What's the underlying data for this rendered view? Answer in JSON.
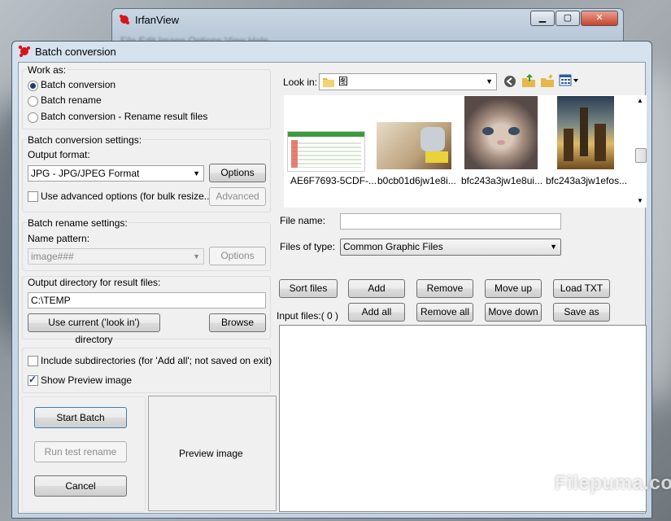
{
  "background_window": {
    "title": "IrfanView",
    "menu": "File Edit Image Options View Help"
  },
  "dialog": {
    "title": "Batch conversion"
  },
  "work_as": {
    "label": "Work as:",
    "options": [
      "Batch conversion",
      "Batch rename",
      "Batch conversion - Rename result files"
    ],
    "selected": "Batch conversion"
  },
  "conversion_settings": {
    "label": "Batch conversion settings:",
    "output_format_label": "Output format:",
    "output_format_value": "JPG - JPG/JPEG Format",
    "options_button": "Options",
    "advanced_checkbox": "Use advanced options (for bulk resize...)",
    "advanced_button": "Advanced"
  },
  "rename_settings": {
    "label": "Batch rename settings:",
    "name_pattern_label": "Name pattern:",
    "name_pattern_value": "image###",
    "options_button": "Options"
  },
  "output_dir": {
    "label": "Output directory for result files:",
    "value": "C:\\TEMP",
    "use_current_button": "Use current ('look in') directory",
    "browse_button": "Browse"
  },
  "include_subdirs": "Include subdirectories (for 'Add all'; not saved on exit)",
  "show_preview": "Show Preview image",
  "actions": {
    "start": "Start Batch",
    "test_rename": "Run test rename",
    "cancel": "Cancel"
  },
  "preview_label": "Preview image",
  "look_in": {
    "label": "Look in:",
    "value": "图"
  },
  "thumbnails": [
    "AE6F7693-5CDF-...",
    "b0cb01d6jw1e8i...",
    "bfc243a3jw1e8ui...",
    "bfc243a3jw1efos..."
  ],
  "file_name_label": "File name:",
  "file_name_value": "",
  "files_of_type": {
    "label": "Files of type:",
    "value": "Common Graphic Files"
  },
  "buttons": {
    "sort_files": "Sort files",
    "add": "Add",
    "remove": "Remove",
    "move_up": "Move up",
    "load_txt": "Load TXT",
    "add_all": "Add all",
    "remove_all": "Remove all",
    "move_down": "Move down",
    "save_as_txt": "Save as TXT"
  },
  "input_files_label": "Input files:( 0 )",
  "watermark": "Filepuma.com"
}
